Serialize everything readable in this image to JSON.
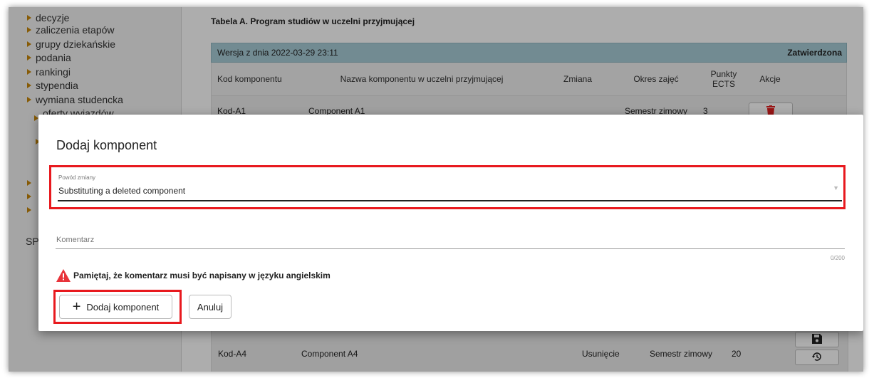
{
  "sidebar": {
    "items": [
      {
        "label": "decyzje"
      },
      {
        "label": "zaliczenia etapów"
      },
      {
        "label": "grupy dziekańskie"
      },
      {
        "label": "podania"
      },
      {
        "label": "rankingi"
      },
      {
        "label": "stypendia"
      },
      {
        "label": "wymiana studencka"
      }
    ],
    "sub_partial": "oferty wyjazdów",
    "partial_text": "SP"
  },
  "table": {
    "title": "Tabela A. Program studiów w uczelni przyjmującej",
    "version_text": "Wersja z dnia 2022-03-29 23:11",
    "status": "Zatwierdzona",
    "columns": [
      "Kod komponentu",
      "Nazwa komponentu w uczelni przyjmującej",
      "Zmiana",
      "Okres zajęć",
      "Punkty ECTS",
      "Akcje"
    ],
    "rows": [
      {
        "code": "Kod-A1",
        "name": "Component A1",
        "change": "",
        "period": "Semestr zimowy",
        "ects": "3"
      },
      {
        "code": "Kod-A4",
        "name": "Component A4",
        "change": "Usunięcie",
        "period": "Semestr zimowy",
        "ects": "20"
      }
    ]
  },
  "dialog": {
    "title": "Dodaj komponent",
    "reason_label": "Powód zmiany",
    "reason_value": "Substituting a deleted component",
    "comment_placeholder": "Komentarz",
    "comment_counter": "0/200",
    "warning": "Pamiętaj, że komentarz musi być napisany w języku angielskim",
    "add_button": "Dodaj komponent",
    "cancel_button": "Anuluj"
  },
  "colors": {
    "highlight": "#e8191e",
    "version_bar": "#a9cdd7",
    "delete": "#e02020",
    "nav_bullet": "#c8860a"
  },
  "icons": [
    "trash-icon",
    "save-icon",
    "history-icon",
    "plus-icon",
    "warning-icon",
    "chevron-down-icon"
  ]
}
